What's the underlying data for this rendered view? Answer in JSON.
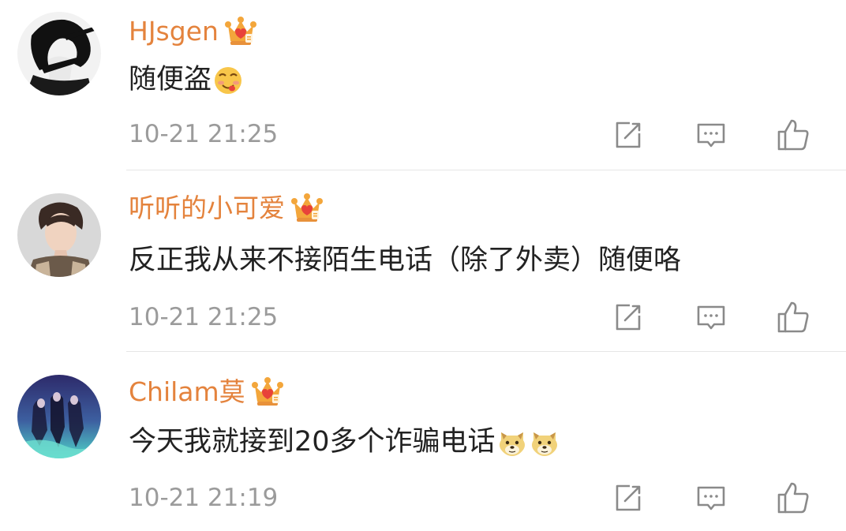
{
  "comments": [
    {
      "username": "HJsgen",
      "vip_badge": "crown-vip-icon",
      "text": "随便盗",
      "emojis": [
        "yummy-face-emoji"
      ],
      "time": "10-21 21:25",
      "actions": [
        "repost-icon",
        "comment-icon",
        "like-icon"
      ]
    },
    {
      "username": "听听的小可爱",
      "vip_badge": "crown-vip-icon",
      "text": "反正我从来不接陌生电话（除了外卖）随便咯",
      "emojis": [],
      "time": "10-21 21:25",
      "actions": [
        "repost-icon",
        "comment-icon",
        "like-icon"
      ]
    },
    {
      "username": "Chilam莫",
      "vip_badge": "crown-vip-icon",
      "text": "今天我就接到20多个诈骗电话",
      "emojis": [
        "doge-emoji",
        "doge-emoji"
      ],
      "time": "10-21 21:19",
      "actions": [
        "repost-icon",
        "comment-icon",
        "like-icon"
      ]
    }
  ],
  "colors": {
    "username": "#e4833d",
    "text": "#222222",
    "time": "#9b9b9b",
    "icon": "#8a8a8a",
    "divider": "#e6e6e6",
    "crown_gold": "#f3a63b",
    "crown_red": "#e8423a"
  }
}
